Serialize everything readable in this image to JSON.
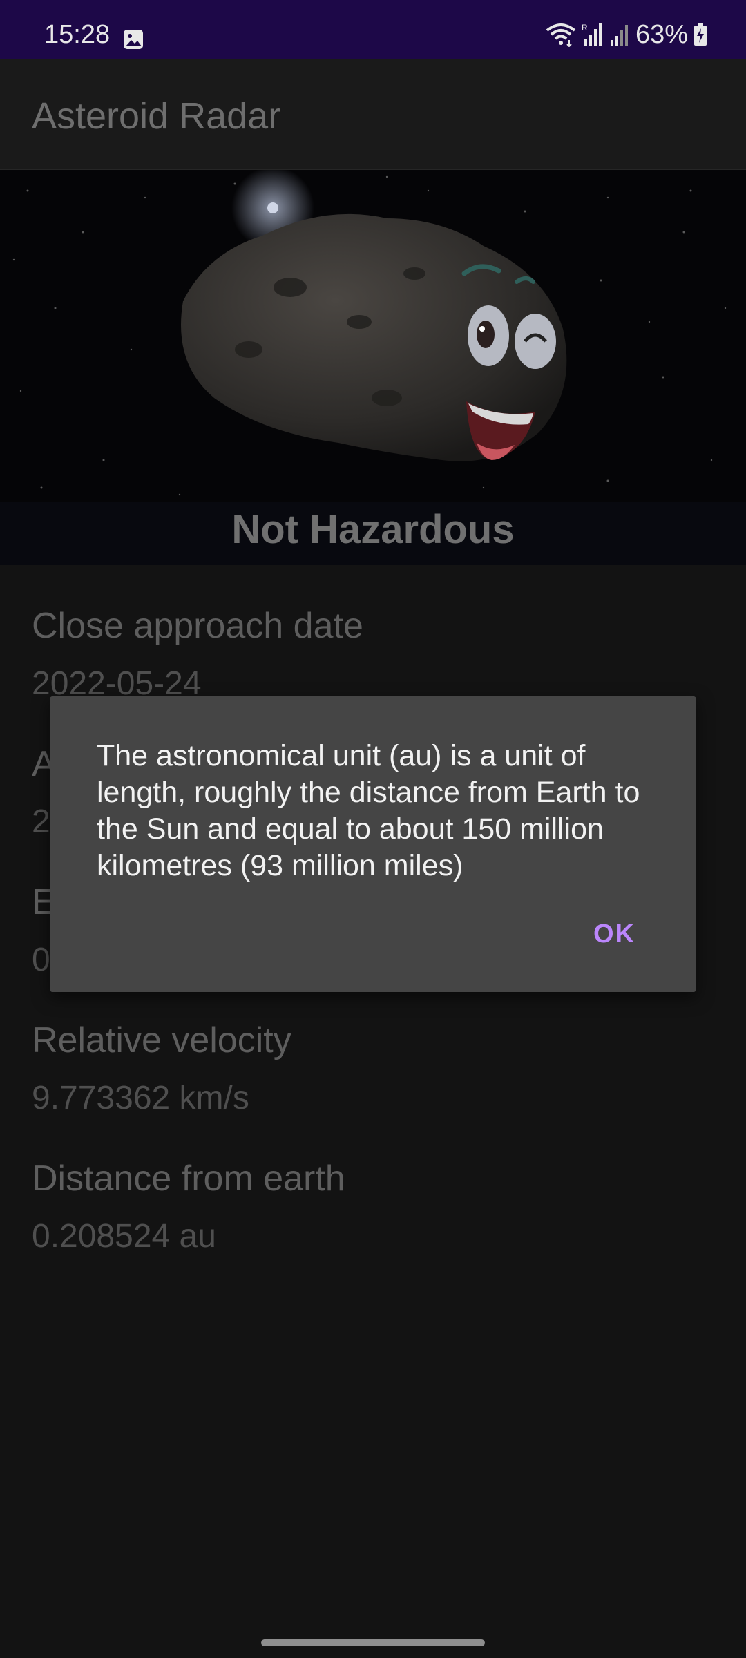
{
  "status_bar": {
    "time": "15:28",
    "battery": "63%",
    "icons": [
      "gallery-icon",
      "wifi-icon",
      "signal-r-icon",
      "signal-icon",
      "battery-charging-icon"
    ]
  },
  "app_bar": {
    "title": "Asteroid Radar"
  },
  "hero": {
    "status_text": "Not Hazardous",
    "image": "smiling-asteroid-image"
  },
  "details": [
    {
      "label": "Close approach date",
      "value": "2022-05-24"
    },
    {
      "label": "A",
      "value": "2"
    },
    {
      "label": "E",
      "value": "0"
    },
    {
      "label": "Relative velocity",
      "value": "9.773362 km/s"
    },
    {
      "label": "Distance from earth",
      "value": "0.208524 au"
    }
  ],
  "dialog": {
    "message": "The astronomical unit (au) is a unit of length, roughly the distance from Earth to the Sun and equal to about 150 million kilometres (93 million miles)",
    "ok_label": "OK"
  },
  "colors": {
    "status_bar": "#1d0848",
    "dialog_bg": "#454545",
    "accent": "#bb86fc"
  }
}
